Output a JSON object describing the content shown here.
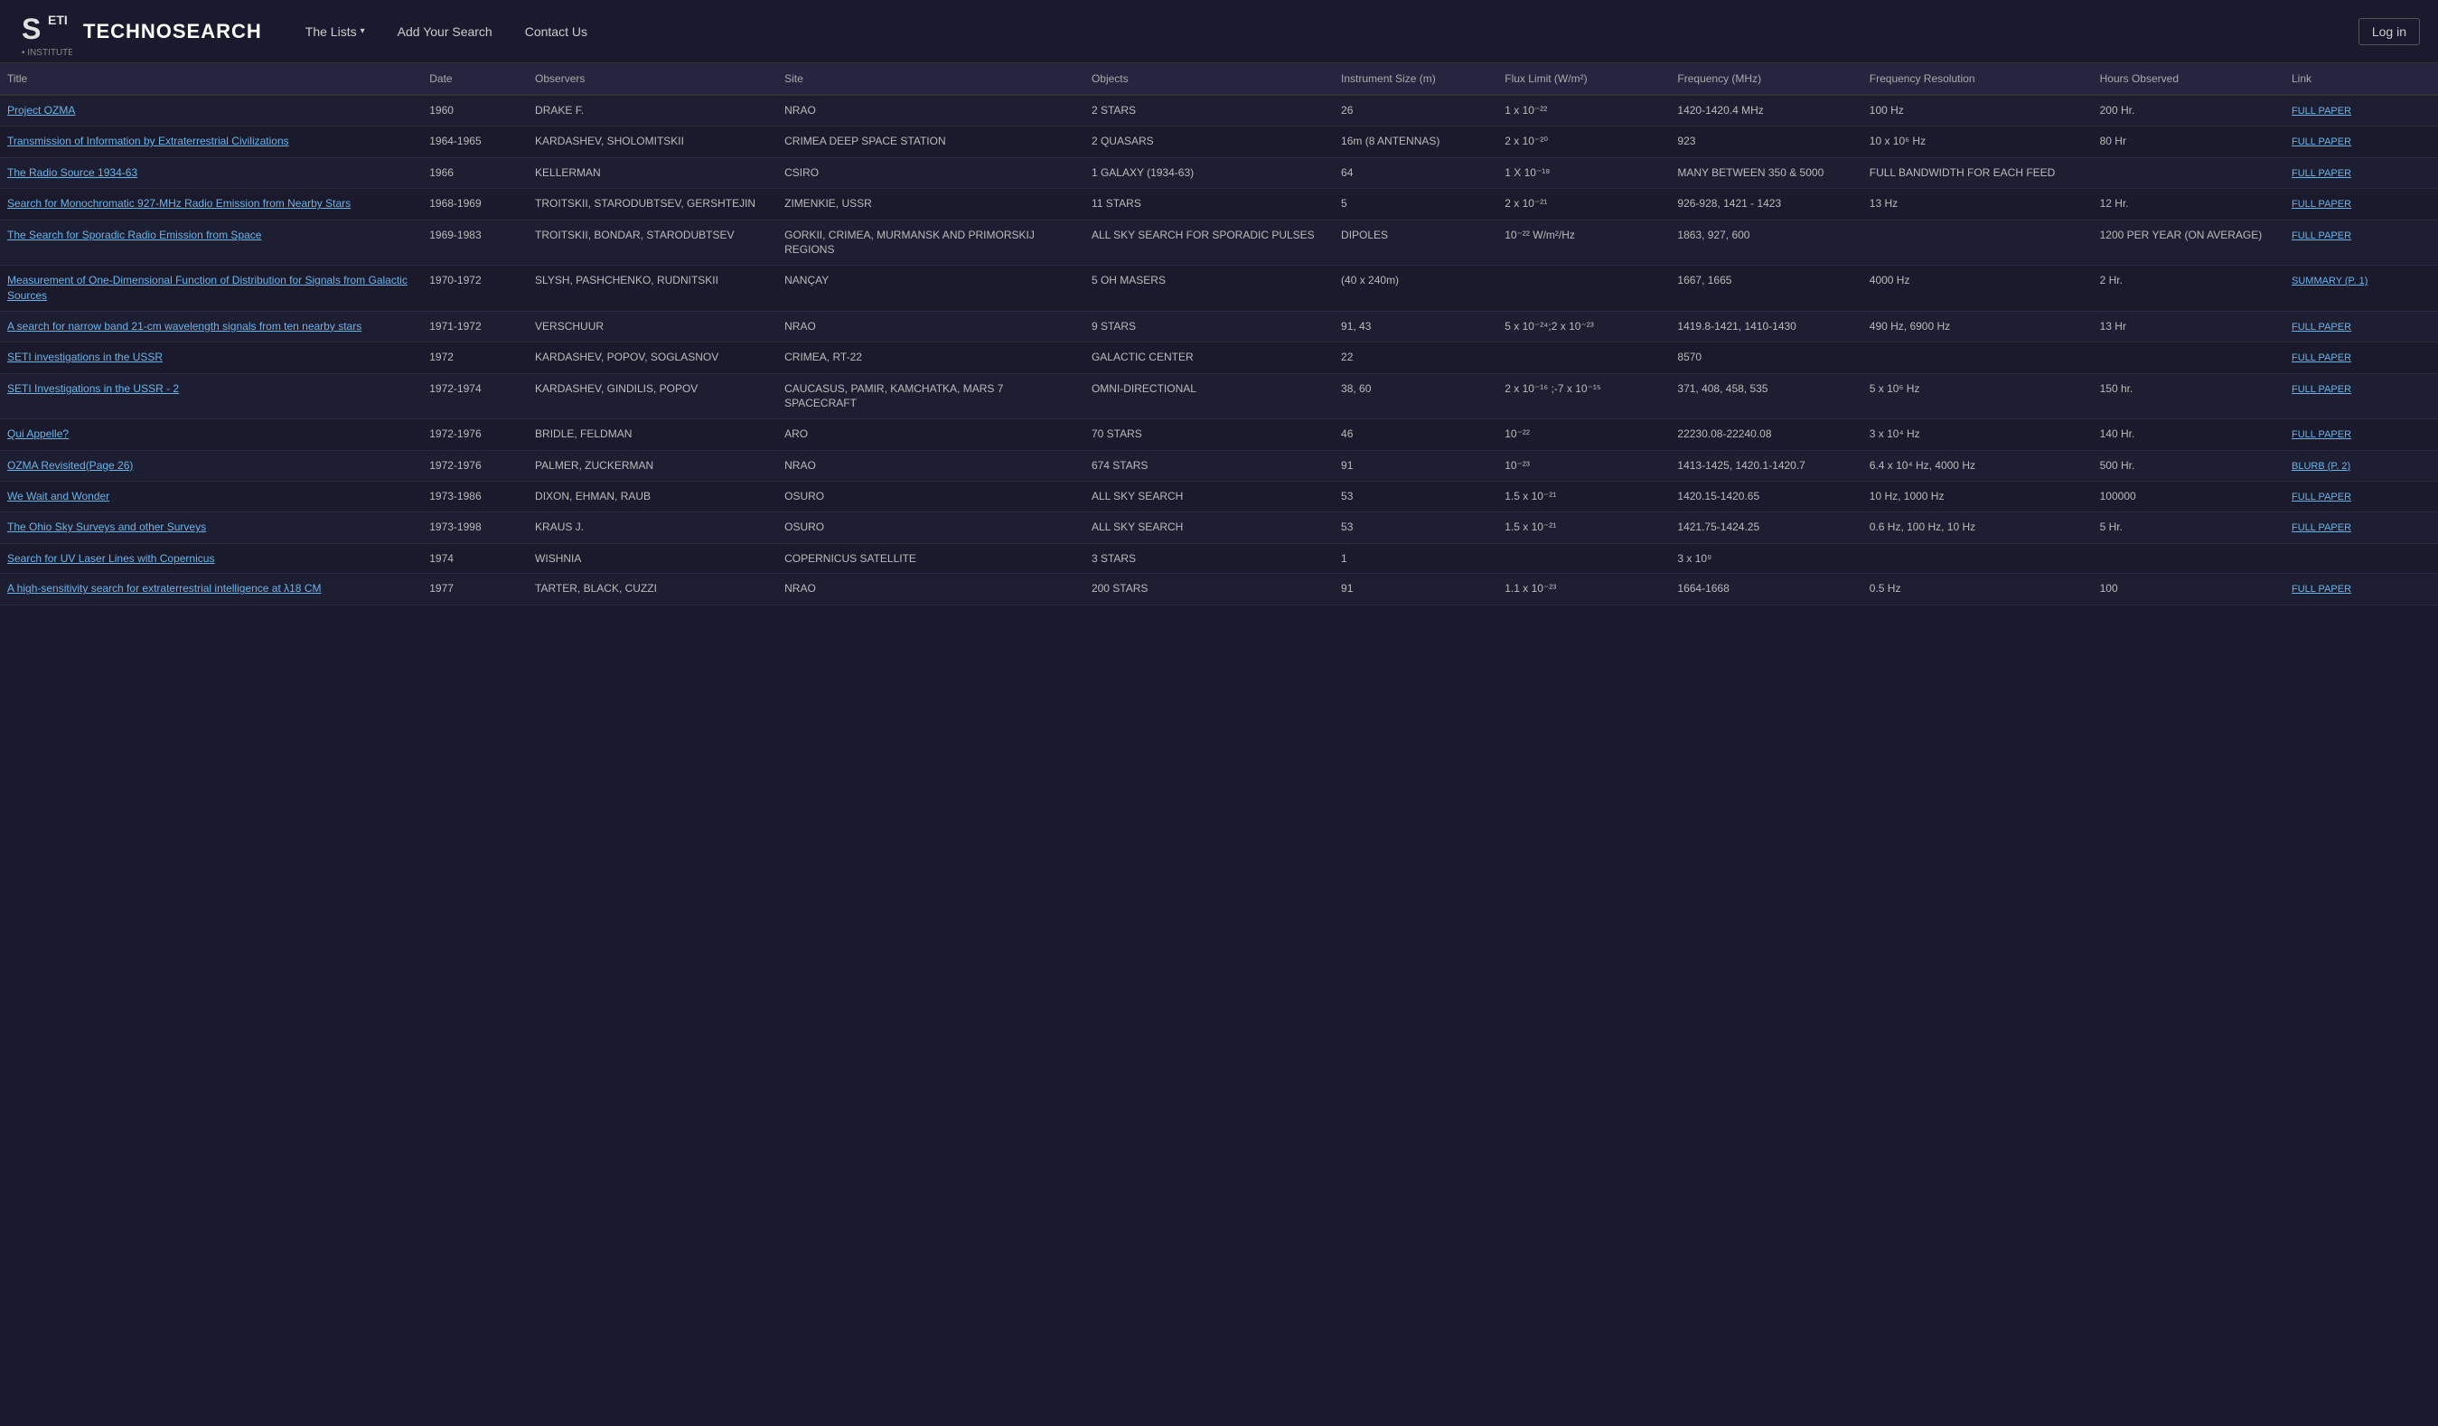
{
  "brand": {
    "name": "TECHNOSEARCH",
    "logo_alt": "SETI Institute"
  },
  "nav": {
    "lists_label": "The Lists",
    "add_search_label": "Add Your Search",
    "contact_label": "Contact Us",
    "login_label": "Log in"
  },
  "table": {
    "headers": [
      {
        "key": "title",
        "label": "Title"
      },
      {
        "key": "date",
        "label": "Date"
      },
      {
        "key": "observers",
        "label": "Observers"
      },
      {
        "key": "site",
        "label": "Site"
      },
      {
        "key": "objects",
        "label": "Objects"
      },
      {
        "key": "instrument",
        "label": "Instrument Size (m)"
      },
      {
        "key": "flux",
        "label": "Flux Limit (W/m²)"
      },
      {
        "key": "freq",
        "label": "Frequency (MHz)"
      },
      {
        "key": "freqres",
        "label": "Frequency Resolution"
      },
      {
        "key": "hours",
        "label": "Hours Observed"
      },
      {
        "key": "link",
        "label": "Link"
      }
    ],
    "rows": [
      {
        "title": "Project OZMA",
        "title_href": "#",
        "date": "1960",
        "observers": "DRAKE F.",
        "site": "NRAO",
        "objects": "2 STARS",
        "instrument": "26",
        "flux": "1 x 10⁻²²",
        "freq": "1420-1420.4 MHz",
        "freqres": "100 Hz",
        "hours": "200 Hr.",
        "link": "FULL PAPER",
        "link_href": "#"
      },
      {
        "title": "Transmission of Information by Extraterrestrial Civilizations",
        "title_href": "#",
        "date": "1964-1965",
        "observers": "KARDASHEV, SHOLOMITSKII",
        "site": "CRIMEA DEEP SPACE STATION",
        "objects": "2 QUASARS",
        "instrument": "16m (8 ANTENNAS)",
        "flux": "2 x 10⁻²⁰",
        "freq": "923",
        "freqres": "10 x 10⁶ Hz",
        "hours": "80 Hr",
        "link": "FULL PAPER",
        "link_href": "#"
      },
      {
        "title": "The Radio Source 1934-63",
        "title_href": "#",
        "date": "1966",
        "observers": "KELLERMAN",
        "site": "CSIRO",
        "objects": "1 GALAXY (1934-63)",
        "instrument": "64",
        "flux": "1 X 10⁻¹⁸",
        "freq": "MANY BETWEEN 350 & 5000",
        "freqres": "FULL BANDWIDTH FOR EACH FEED",
        "hours": "",
        "link": "FULL PAPER",
        "link_href": "#"
      },
      {
        "title": "Search for Monochromatic 927-MHz Radio Emission from Nearby Stars",
        "title_href": "#",
        "date": "1968-1969",
        "observers": "TROITSKII, STARODUBTSEV, GERSHTEJIN",
        "site": "ZIMENKIE, USSR",
        "objects": "11 STARS",
        "instrument": "5",
        "flux": "2 x 10⁻²¹",
        "freq": "926-928, 1421 - 1423",
        "freqres": "13 Hz",
        "hours": "12 Hr.",
        "link": "FULL PAPER",
        "link_href": "#"
      },
      {
        "title": "The Search for Sporadic Radio Emission from Space",
        "title_href": "#",
        "date": "1969-1983",
        "observers": "TROITSKII, BONDAR, STARODUBTSEV",
        "site": "GORKII, CRIMEA, MURMANSK AND PRIMORSKIJ REGIONS",
        "objects": "ALL SKY SEARCH FOR SPORADIC PULSES",
        "instrument": "DIPOLES",
        "flux": "10⁻²² W/m²/Hz",
        "freq": "1863, 927, 600",
        "freqres": "",
        "hours": "1200 PER YEAR (ON AVERAGE)",
        "link": "FULL PAPER",
        "link_href": "#"
      },
      {
        "title": "Measurement of One-Dimensional Function of Distribution for Signals from Galactic Sources",
        "title_href": "#",
        "date": "1970-1972",
        "observers": "SLYSH, PASHCHENKO, RUDNITSKII",
        "site": "NANÇAY",
        "objects": "5 OH MASERS",
        "instrument": "(40 x 240m)",
        "flux": "",
        "freq": "1667, 1665",
        "freqres": "4000 Hz",
        "hours": "2 Hr.",
        "link": "SUMMARY (P. 1)",
        "link_href": "#"
      },
      {
        "title": "A search for narrow band 21-cm wavelength signals from ten nearby stars",
        "title_href": "#",
        "date": "1971-1972",
        "observers": "VERSCHUUR",
        "site": "NRAO",
        "objects": "9 STARS",
        "instrument": "91, 43",
        "flux": "5 x 10⁻²⁴;2 x 10⁻²³",
        "freq": "1419.8-1421, 1410-1430",
        "freqres": "490 Hz, 6900 Hz",
        "hours": "13 Hr",
        "link": "FULL PAPER",
        "link_href": "#"
      },
      {
        "title": "SETI investigations in the USSR",
        "title_href": "#",
        "date": "1972",
        "observers": "KARDASHEV, POPOV, SOGLASNOV",
        "site": "CRIMEA, RT-22",
        "objects": "GALACTIC CENTER",
        "instrument": "22",
        "flux": "",
        "freq": "8570",
        "freqres": "",
        "hours": "",
        "link": "FULL PAPER",
        "link_href": "#"
      },
      {
        "title": "SETI Investigations in the USSR - 2",
        "title_href": "#",
        "date": "1972-1974",
        "observers": "KARDASHEV, GINDILIS, POPOV",
        "site": "CAUCASUS, PAMIR, KAMCHATKA, MARS 7 SPACECRAFT",
        "objects": "OMNI-DIRECTIONAL",
        "instrument": "38, 60",
        "flux": "2 x 10⁻¹⁶ ;-7 x 10⁻¹⁵",
        "freq": "371, 408, 458, 535",
        "freqres": "5 x 10⁶ Hz",
        "hours": "150 hr.",
        "link": "FULL PAPER",
        "link_href": "#"
      },
      {
        "title": "Qui Appelle?",
        "title_href": "#",
        "date": "1972-1976",
        "observers": "BRIDLE, FELDMAN",
        "site": "ARO",
        "objects": "70 STARS",
        "instrument": "46",
        "flux": "10⁻²²",
        "freq": "22230.08-22240.08",
        "freqres": "3 x 10⁴ Hz",
        "hours": "140 Hr.",
        "link": "FULL PAPER",
        "link_href": "#"
      },
      {
        "title": "OZMA Revisited(Page 26)",
        "title_href": "#",
        "date": "1972-1976",
        "observers": "PALMER, ZUCKERMAN",
        "site": "NRAO",
        "objects": "674 STARS",
        "instrument": "91",
        "flux": "10⁻²³",
        "freq": "1413-1425, 1420.1-1420.7",
        "freqres": "6.4 x 10⁴ Hz, 4000 Hz",
        "hours": "500 Hr.",
        "link": "BLURB (P. 2)",
        "link_href": "#"
      },
      {
        "title": "We Wait and Wonder",
        "title_href": "#",
        "date": "1973-1986",
        "observers": "DIXON, EHMAN, RAUB",
        "site": "OSURO",
        "objects": "ALL SKY SEARCH",
        "instrument": "53",
        "flux": "1.5 x 10⁻²¹",
        "freq": "1420.15-1420.65",
        "freqres": "10 Hz, 1000 Hz",
        "hours": "100000",
        "link": "FULL PAPER",
        "link_href": "#"
      },
      {
        "title": "The Ohio Sky Surveys and other Surveys",
        "title_href": "#",
        "date": "1973-1998",
        "observers": "KRAUS J.",
        "site": "OSURO",
        "objects": "ALL SKY SEARCH",
        "instrument": "53",
        "flux": "1.5 x 10⁻²¹",
        "freq": "1421.75-1424.25",
        "freqres": "0.6 Hz, 100 Hz, 10 Hz",
        "hours": "5 Hr.",
        "link": "FULL PAPER",
        "link_href": "#"
      },
      {
        "title": "Search for UV Laser Lines with Copernicus",
        "title_href": "#",
        "date": "1974",
        "observers": "WISHNIA",
        "site": "COPERNICUS SATELLITE",
        "objects": "3 STARS",
        "instrument": "1",
        "flux": "",
        "freq": "3 x 10⁹",
        "freqres": "",
        "hours": "",
        "link": "",
        "link_href": "#"
      },
      {
        "title": "A high-sensitivity search for extraterrestrial intelligence at λ18 CM",
        "title_href": "#",
        "date": "1977",
        "observers": "TARTER, BLACK, CUZZI",
        "site": "NRAO",
        "objects": "200 STARS",
        "instrument": "91",
        "flux": "1.1 x 10⁻²³",
        "freq": "1664-1668",
        "freqres": "0.5 Hz",
        "hours": "100",
        "link": "FULL PAPER",
        "link_href": "#"
      }
    ]
  }
}
